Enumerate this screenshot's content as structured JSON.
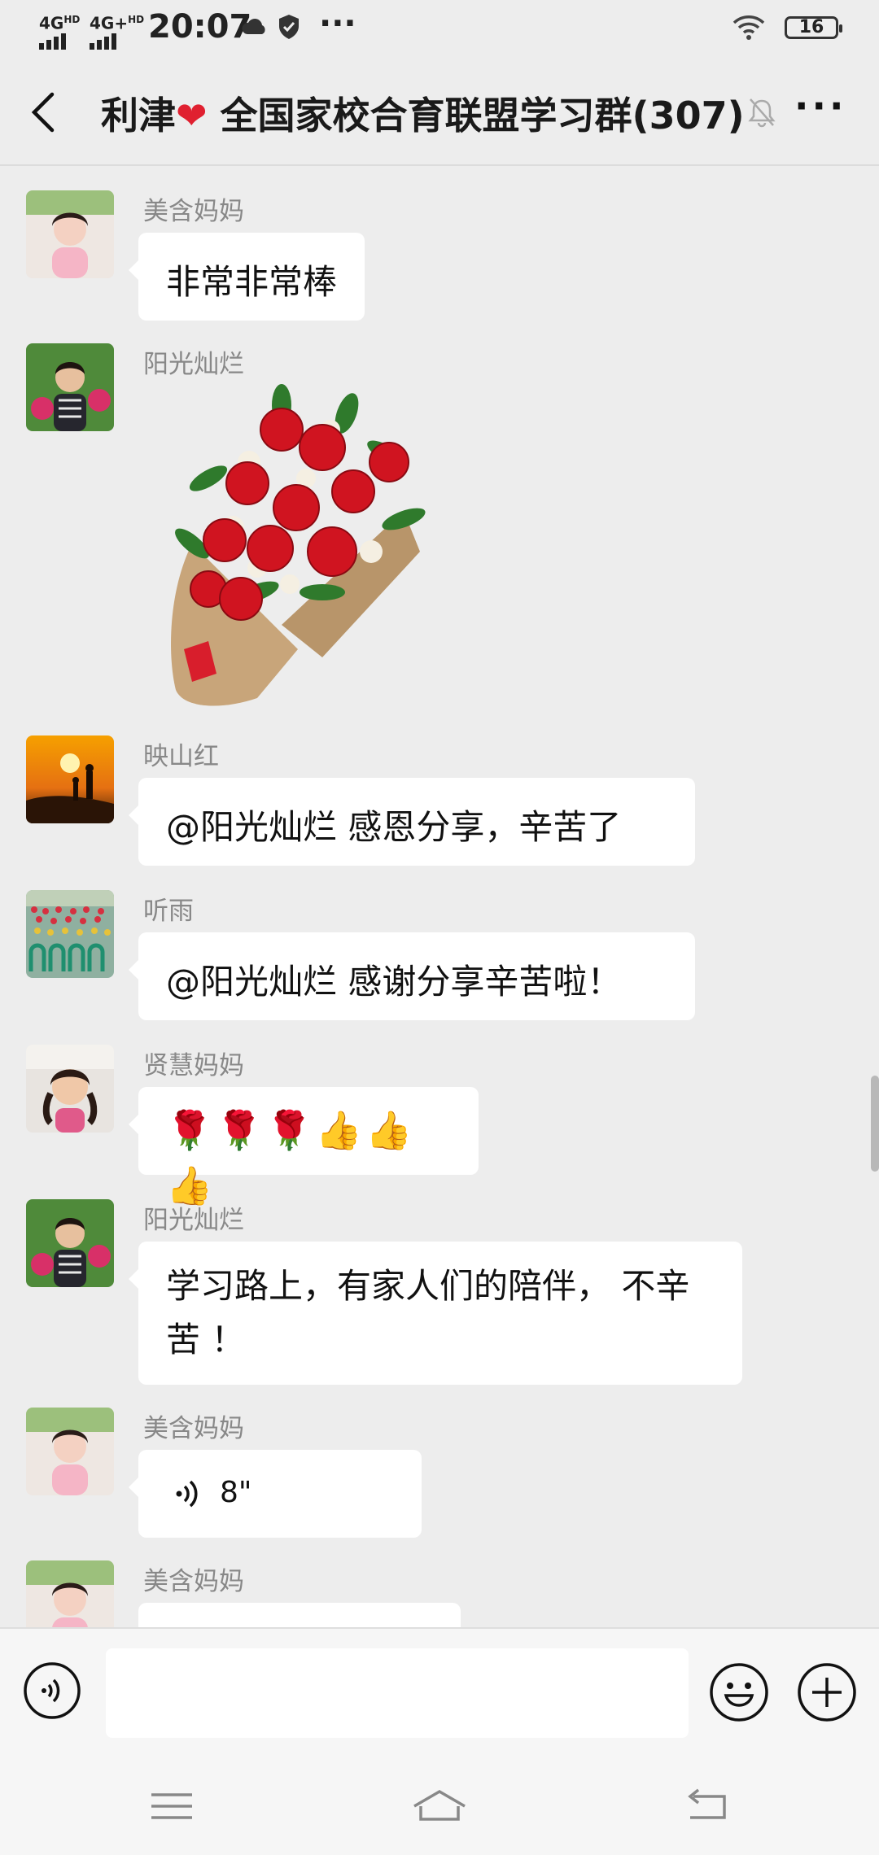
{
  "status_bar": {
    "net1": "4G",
    "net1_sup": "HD",
    "net2": "4G+",
    "net2_sup": "HD",
    "time": "20:07",
    "dots": "···",
    "battery": "16"
  },
  "header": {
    "title_pre": "利津",
    "title_heart": "❤",
    "title_post": " 全国家校合育联盟学习群(307)",
    "more": "···"
  },
  "messages": [
    {
      "sender": "美含妈妈",
      "type": "text",
      "text": "非常非常棒"
    },
    {
      "sender": "阳光灿烂",
      "type": "sticker",
      "sticker": "rose-bouquet"
    },
    {
      "sender": "映山红",
      "type": "text",
      "text": "@阳光灿烂  感恩分享，辛苦了"
    },
    {
      "sender": "听雨",
      "type": "text",
      "text": "@阳光灿烂  感谢分享辛苦啦！"
    },
    {
      "sender": "贤慧妈妈",
      "type": "emoji",
      "text": "🌹🌹🌹👍👍👍"
    },
    {
      "sender": "阳光灿烂",
      "type": "text",
      "line1": "学习路上，有家人们的陪伴， 不辛",
      "line2": "苦 ！"
    },
    {
      "sender": "美含妈妈",
      "type": "voice",
      "duration": "8\""
    },
    {
      "sender": "美含妈妈",
      "type": "voice-partial"
    }
  ],
  "colors": {
    "background": "#ededed",
    "bubble": "#ffffff",
    "nick": "#888888",
    "heart": "#e02030"
  }
}
